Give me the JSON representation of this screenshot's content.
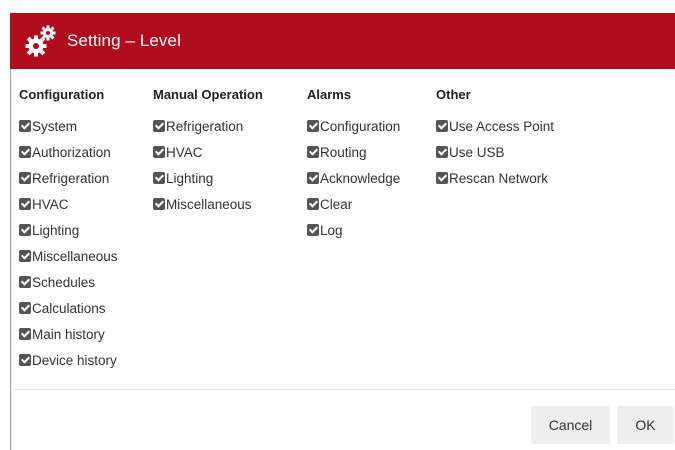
{
  "dialog": {
    "title": "Setting – Level",
    "title_icon": "gears-icon",
    "accent_color": "#b10b1e"
  },
  "columns": [
    {
      "header": "Configuration",
      "items": [
        {
          "label": "System",
          "checked": true
        },
        {
          "label": "Authorization",
          "checked": true
        },
        {
          "label": "Refrigeration",
          "checked": true
        },
        {
          "label": "HVAC",
          "checked": true
        },
        {
          "label": "Lighting",
          "checked": true
        },
        {
          "label": "Miscellaneous",
          "checked": true
        },
        {
          "label": "Schedules",
          "checked": true
        },
        {
          "label": "Calculations",
          "checked": true
        },
        {
          "label": "Main history",
          "checked": true
        },
        {
          "label": "Device history",
          "checked": true
        }
      ]
    },
    {
      "header": "Manual Operation",
      "items": [
        {
          "label": "Refrigeration",
          "checked": true
        },
        {
          "label": "HVAC",
          "checked": true
        },
        {
          "label": "Lighting",
          "checked": true
        },
        {
          "label": "Miscellaneous",
          "checked": true
        }
      ]
    },
    {
      "header": "Alarms",
      "items": [
        {
          "label": "Configuration",
          "checked": true
        },
        {
          "label": "Routing",
          "checked": true
        },
        {
          "label": "Acknowledge",
          "checked": true
        },
        {
          "label": "Clear",
          "checked": true
        },
        {
          "label": "Log",
          "checked": true
        }
      ]
    },
    {
      "header": "Other",
      "items": [
        {
          "label": "Use Access Point",
          "checked": true
        },
        {
          "label": "Use USB",
          "checked": true
        },
        {
          "label": "Rescan Network",
          "checked": true
        }
      ]
    }
  ],
  "footer": {
    "cancel_label": "Cancel",
    "ok_label": "OK"
  }
}
